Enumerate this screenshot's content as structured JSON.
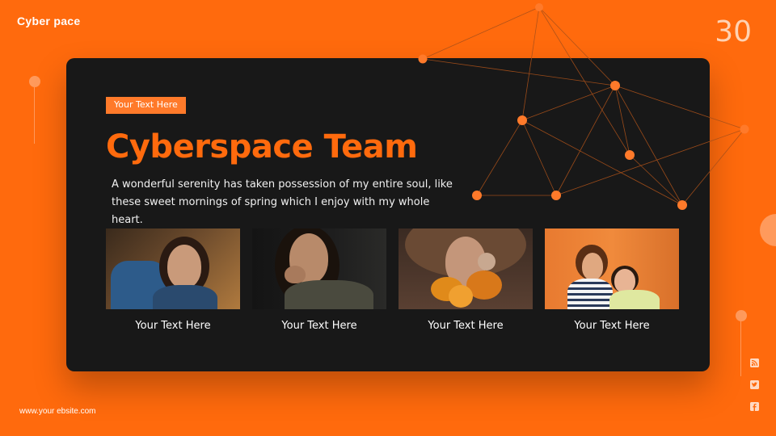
{
  "header": {
    "brand": "Cyber pace",
    "page_number": "30"
  },
  "slide": {
    "tag": "Your Text Here",
    "title": "Cyberspace Team",
    "description": "A wonderful serenity has taken possession of my entire soul, like these sweet mornings of spring which I enjoy with my whole heart."
  },
  "team": [
    {
      "name": "Your Text Here",
      "photo": "woman-smiling-photo"
    },
    {
      "name": "Your Text Here",
      "photo": "woman-portrait-photo"
    },
    {
      "name": "Your Text Here",
      "photo": "woman-with-flowers-photo"
    },
    {
      "name": "Your Text Here",
      "photo": "couple-photo"
    }
  ],
  "footer": {
    "website": "www.your  ebsite.com"
  },
  "social": [
    "rss-icon",
    "twitter-icon",
    "facebook-icon"
  ],
  "colors": {
    "background": "#ff6a0d",
    "card": "#181818",
    "accent": "#ff6a0d",
    "tag": "#ff7a2a",
    "network_node": "#ff7a2a"
  }
}
